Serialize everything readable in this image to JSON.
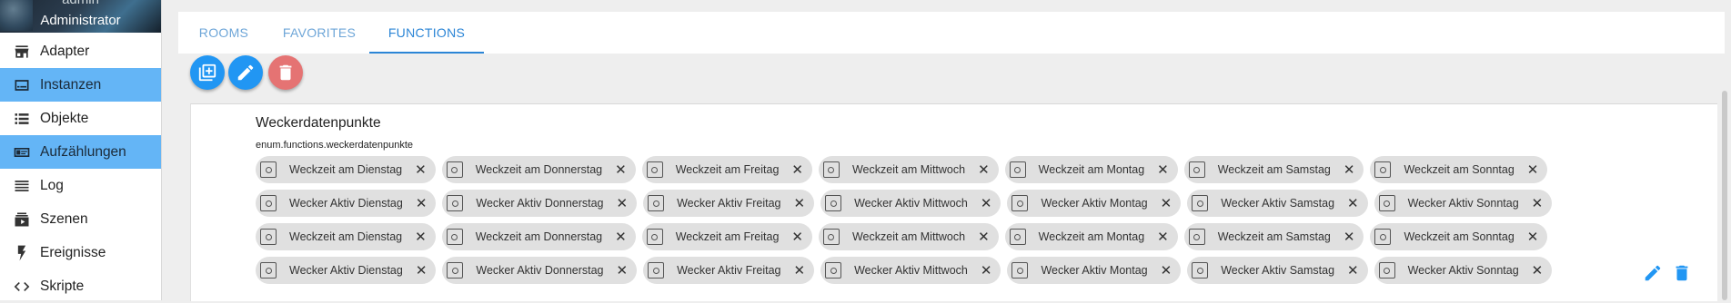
{
  "sidebar": {
    "user_name": "admin",
    "user_role": "Administrator",
    "items": [
      {
        "label": "Adapter",
        "icon": "adapter-icon",
        "active": false
      },
      {
        "label": "Instanzen",
        "icon": "instances-icon",
        "active": true
      },
      {
        "label": "Objekte",
        "icon": "objects-list-icon",
        "active": false
      },
      {
        "label": "Aufzählungen",
        "icon": "enums-icon",
        "active": true
      },
      {
        "label": "Log",
        "icon": "log-icon",
        "active": false
      },
      {
        "label": "Szenen",
        "icon": "scenes-icon",
        "active": false
      },
      {
        "label": "Ereignisse",
        "icon": "events-bolt-icon",
        "active": false
      },
      {
        "label": "Skripte",
        "icon": "scripts-code-icon",
        "active": false
      }
    ]
  },
  "tabs": [
    {
      "label": "ROOMS",
      "active": false
    },
    {
      "label": "FAVORITES",
      "active": false
    },
    {
      "label": "FUNCTIONS",
      "active": true
    }
  ],
  "toolbar": {
    "add_icon": "add-enum-icon",
    "edit_icon": "edit-pencil-icon",
    "delete_icon": "delete-trash-icon"
  },
  "enum": {
    "title": "Weckerdatenpunkte",
    "id": "enum.functions.weckerdatenpunkte",
    "rows": [
      [
        "Weckzeit am Dienstag",
        "Weckzeit am Donnerstag",
        "Weckzeit am Freitag",
        "Weckzeit am Mittwoch",
        "Weckzeit am Montag",
        "Weckzeit am Samstag",
        "Weckzeit am Sonntag"
      ],
      [
        "Wecker Aktiv Dienstag",
        "Wecker Aktiv Donnerstag",
        "Wecker Aktiv Freitag",
        "Wecker Aktiv Mittwoch",
        "Wecker Aktiv Montag",
        "Wecker Aktiv Samstag",
        "Wecker Aktiv Sonntag"
      ],
      [
        "Weckzeit am Dienstag",
        "Weckzeit am Donnerstag",
        "Weckzeit am Freitag",
        "Weckzeit am Mittwoch",
        "Weckzeit am Montag",
        "Weckzeit am Samstag",
        "Weckzeit am Sonntag"
      ],
      [
        "Wecker Aktiv Dienstag",
        "Wecker Aktiv Donnerstag",
        "Wecker Aktiv Freitag",
        "Wecker Aktiv Mittwoch",
        "Wecker Aktiv Montag",
        "Wecker Aktiv Samstag",
        "Wecker Aktiv Sonntag"
      ]
    ],
    "chip_close_glyph": "✕"
  },
  "colors": {
    "accent": "#2196f3",
    "sidebar_active": "#64b5f6",
    "delete": "#e57373",
    "chip_bg": "#e0e0e0",
    "row_action": "#2196f3"
  }
}
